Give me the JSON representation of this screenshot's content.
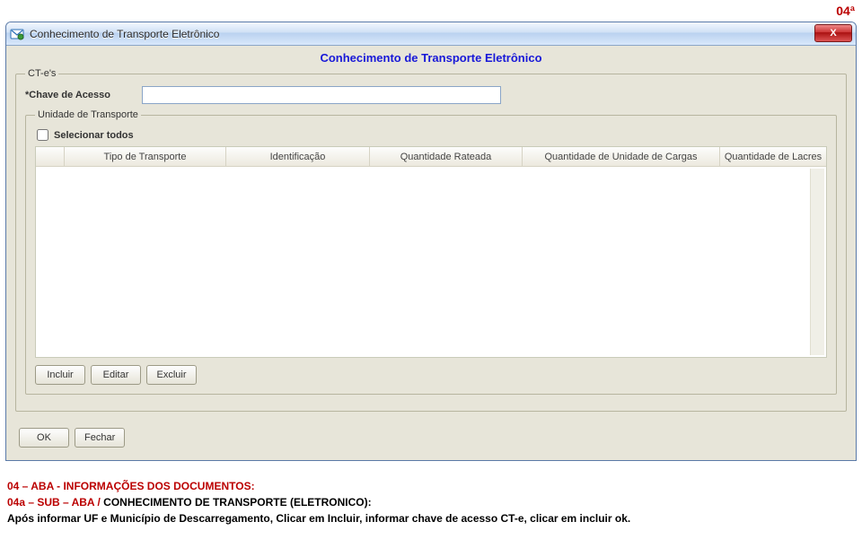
{
  "page_marker": "04ª",
  "window": {
    "title": "Conhecimento de Transporte Eletrônico",
    "inner_title": "Conhecimento de Transporte Eletrônico",
    "close_symbol": "X"
  },
  "ctes": {
    "legend": "CT-e's",
    "chave_label": "*Chave de Acesso",
    "chave_value": ""
  },
  "unidade": {
    "legend": "Unidade de Transporte",
    "selecionar_todos": "Selecionar todos",
    "columns": {
      "c1": "Tipo de Transporte",
      "c2": "Identificação",
      "c3": "Quantidade Rateada",
      "c4": "Quantidade de Unidade de Cargas",
      "c5": "Quantidade de Lacres"
    }
  },
  "buttons": {
    "incluir": "Incluir",
    "editar": "Editar",
    "excluir": "Excluir",
    "ok": "OK",
    "fechar": "Fechar"
  },
  "notes": {
    "l1_a": "04 – ABA - INFORMAÇÕES DOS DOCUMENTOS:",
    "l2_a": "04a – SUB – ABA  /  ",
    "l2_b": "CONHECIMENTO DE TRANSPORTE (ELETRONICO):",
    "l3": "Após informar UF e Município de Descarregamento, Clicar em Incluir, informar chave de acesso CT-e,  clicar em incluir ok."
  }
}
